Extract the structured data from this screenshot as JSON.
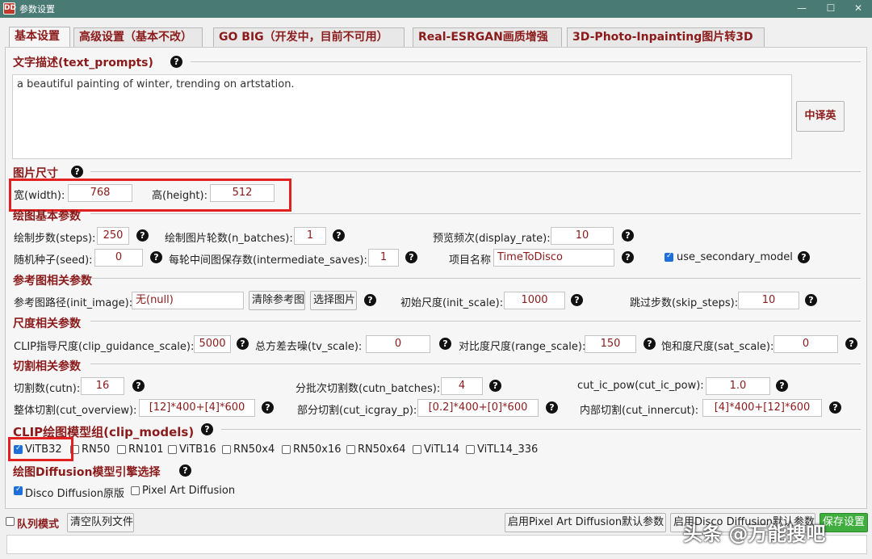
{
  "window": {
    "title": "参数设置",
    "app_icon": "DD",
    "min": "—",
    "max": "☐",
    "close": "✕"
  },
  "tabs": [
    {
      "label": "基本设置"
    },
    {
      "label": "高级设置（基本不改）"
    },
    {
      "label": "GO BIG（开发中，目前不可用）"
    },
    {
      "label": "Real-ESRGAN画质增强"
    },
    {
      "label": "3D-Photo-Inpainting图片转3D"
    }
  ],
  "text_prompts": {
    "heading": "文字描述(text_prompts)",
    "value": "a beautiful painting of winter, trending on artstation.",
    "translate_button": "中译英"
  },
  "image_size": {
    "heading": "图片尺寸",
    "width_label": "宽(width):",
    "width_value": "768",
    "height_label": "高(height):",
    "height_value": "512"
  },
  "basic": {
    "heading": "绘图基本参数",
    "steps_label": "绘制步数(steps):",
    "steps_value": "250",
    "n_batches_label": "绘制图片轮数(n_batches):",
    "n_batches_value": "1",
    "display_rate_label": "预览频次(display_rate):",
    "display_rate_value": "10",
    "seed_label": "随机种子(seed):",
    "seed_value": "0",
    "intermediate_label": "每轮中间图保存数(intermediate_saves):",
    "intermediate_value": "1",
    "project_label": "项目名称",
    "project_value": "TimeToDisco",
    "secondary_label": "use_secondary_model",
    "secondary_checked": true
  },
  "init": {
    "heading": "参考图相关参数",
    "path_label": "参考图路径(init_image):",
    "path_value": "无(null)",
    "clear_button": "清除参考图",
    "choose_button": "选择图片",
    "scale_label": "初始尺度(init_scale):",
    "scale_value": "1000",
    "skip_label": "跳过步数(skip_steps):",
    "skip_value": "10"
  },
  "scales": {
    "heading": "尺度相关参数",
    "clip_label": "CLIP指导尺度(clip_guidance_scale):",
    "clip_value": "5000",
    "tv_label": "总方差去噪(tv_scale):",
    "tv_value": "0",
    "range_label": "对比度尺度(range_scale):",
    "range_value": "150",
    "sat_label": "饱和度尺度(sat_scale):",
    "sat_value": "0"
  },
  "cuts": {
    "heading": "切割相关参数",
    "cutn_label": "切割数(cutn):",
    "cutn_value": "16",
    "cutn_batches_label": "分批次切割数(cutn_batches):",
    "cutn_batches_value": "4",
    "ic_pow_label": "cut_ic_pow(cut_ic_pow):",
    "ic_pow_value": "1.0",
    "overview_label": "整体切割(cut_overview):",
    "overview_value": "[12]*400+[4]*600",
    "icgray_label": "部分切割(cut_icgray_p):",
    "icgray_value": "[0.2]*400+[0]*600",
    "innercut_label": "内部切割(cut_innercut):",
    "innercut_value": "[4]*400+[12]*600"
  },
  "clip_models": {
    "heading": "CLIP绘图模型组(clip_models)",
    "items": [
      {
        "label": "ViTB32",
        "checked": true
      },
      {
        "label": "RN50",
        "checked": false
      },
      {
        "label": "RN101",
        "checked": false
      },
      {
        "label": "ViTB16",
        "checked": false
      },
      {
        "label": "RN50x4",
        "checked": false
      },
      {
        "label": "RN50x16",
        "checked": false
      },
      {
        "label": "RN50x64",
        "checked": false
      },
      {
        "label": "ViTL14",
        "checked": false
      },
      {
        "label": "ViTL14_336",
        "checked": false
      }
    ]
  },
  "engine": {
    "heading": "绘图Diffusion模型引擎选择",
    "disco_label": "Disco Diffusion原版",
    "disco_checked": true,
    "pixel_label": "Pixel Art Diffusion",
    "pixel_checked": false
  },
  "bottom": {
    "queue_label": "队列模式",
    "clear_queue_button": "清空队列文件",
    "pixel_defaults_button": "启用Pixel Art Diffusion默认参数",
    "disco_defaults_button": "启用Disco Diffusion默认参数",
    "save_button": "保存设置"
  },
  "watermark": "头条 @万能搜吧",
  "help_glyph": "?"
}
